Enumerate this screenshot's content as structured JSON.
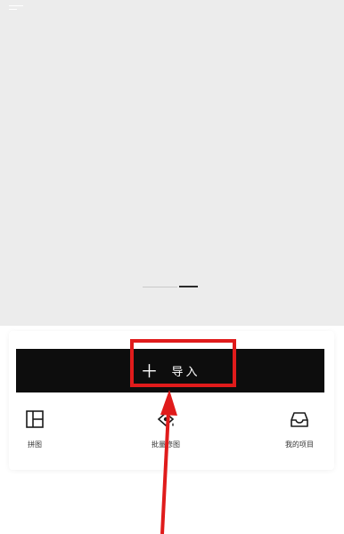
{
  "import_button": {
    "plus": "＋",
    "label": "导入"
  },
  "actions": [
    {
      "label": "拼图",
      "icon": "collage-icon"
    },
    {
      "label": "批量修图",
      "icon": "batch-edit-icon"
    },
    {
      "label": "我的项目",
      "icon": "inbox-icon"
    }
  ],
  "colors": {
    "hero_bg": "#ececec",
    "button_bg": "#0d0d0d",
    "annotation": "#e01b1b"
  },
  "carousel": {
    "pages": 2,
    "active_page": 2
  }
}
